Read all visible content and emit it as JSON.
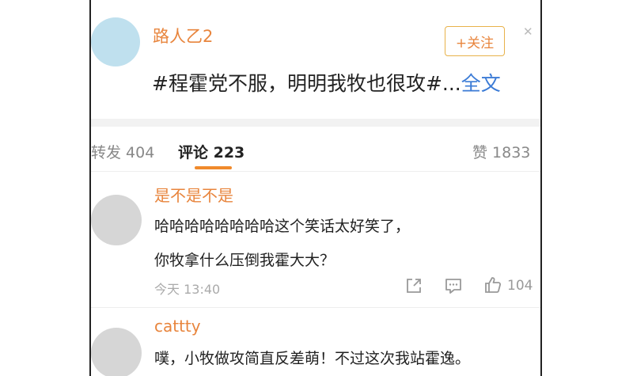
{
  "post": {
    "username": "路人乙2",
    "follow_label": "+关注",
    "close_icon": "close-icon",
    "text": "#程霍党不服，明明我牧也很攻#...",
    "more_label": "全文"
  },
  "tabs": {
    "repost": "转发 404",
    "comment": "评论 223",
    "like": "赞 1833",
    "active": "comment",
    "accent_color": "#f08a2c"
  },
  "comments": [
    {
      "username": "是不是不是",
      "lines": [
        "哈哈哈哈哈哈哈哈这个笑话太好笑了，",
        "你牧拿什么压倒我霍大大？"
      ],
      "time": "今天 13:40",
      "like_count": "104",
      "icons": [
        "share-icon",
        "reply-icon",
        "thumbs-up-icon"
      ]
    },
    {
      "username": "cattty",
      "lines": [
        "噗，小牧做攻简直反差萌！不过这次我站霍逸。"
      ]
    }
  ],
  "colors": {
    "username": "#e8853d",
    "link": "#3b7bd6",
    "avatar_post": "#bfe0ee",
    "avatar_comment": "#d6d6d6"
  }
}
